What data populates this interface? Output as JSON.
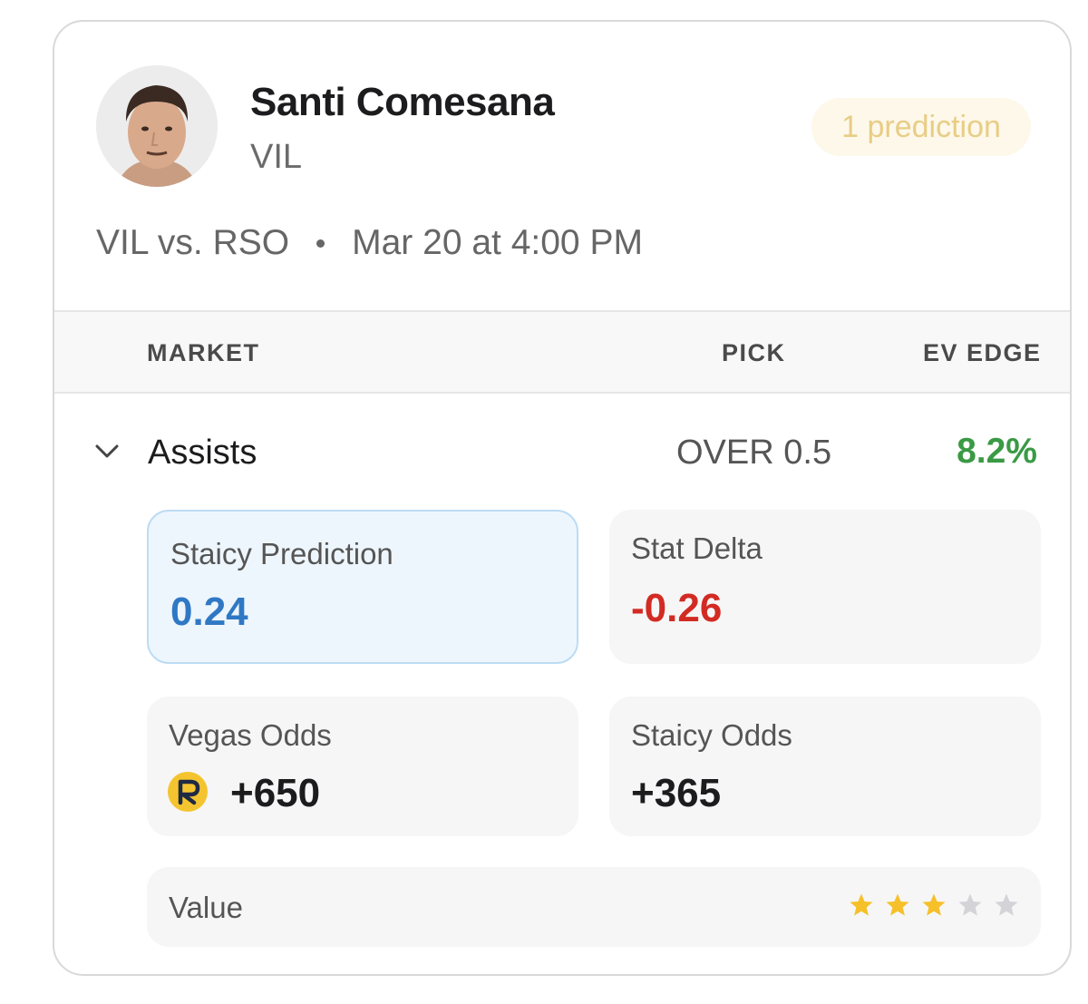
{
  "player": {
    "name": "Santi Comesana",
    "team": "VIL",
    "predictions_badge": "1 prediction"
  },
  "match": {
    "teams": "VIL vs. RSO",
    "datetime": "Mar 20 at 4:00 PM"
  },
  "table": {
    "headers": {
      "market": "MARKET",
      "pick": "PICK",
      "ev_edge": "EV EDGE"
    },
    "row": {
      "market": "Assists",
      "pick": "OVER 0.5",
      "ev_edge": "8.2%",
      "ev_color": "#3a9a45"
    }
  },
  "details": {
    "staicy_prediction": {
      "label": "Staicy Prediction",
      "value": "0.24",
      "color": "#2f78c4"
    },
    "stat_delta": {
      "label": "Stat Delta",
      "value": "-0.26",
      "color": "#d22b23"
    },
    "vegas_odds": {
      "label": "Vegas Odds",
      "value": "+650",
      "book_icon": "sportsbook-logo-icon"
    },
    "staicy_odds": {
      "label": "Staicy Odds",
      "value": "+365"
    },
    "value_rating": {
      "label": "Value",
      "stars_filled": 3,
      "stars_total": 5,
      "star_color": "#f5c02a",
      "star_empty_color": "#d3d3d8"
    }
  }
}
